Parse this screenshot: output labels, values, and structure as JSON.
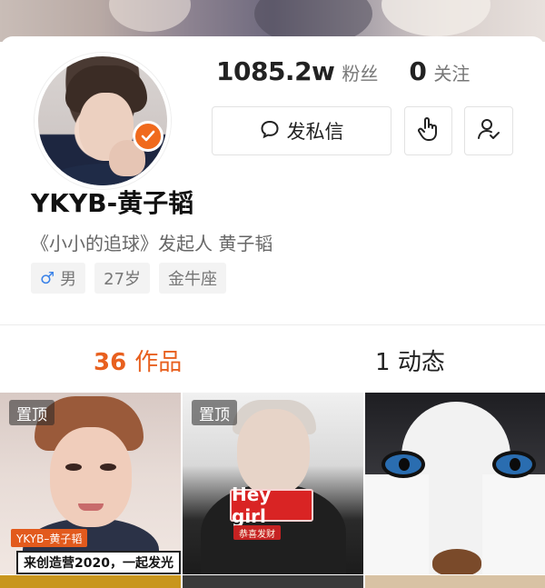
{
  "profile": {
    "followers_count": "1085.2w",
    "followers_label": "粉丝",
    "following_count": "0",
    "following_label": "关注",
    "message_button_label": "发私信",
    "name": "YKYB-黄子韬",
    "bio": "《小小的追球》发起人 黄子韬",
    "tags": {
      "gender_symbol": "♂",
      "gender": "男",
      "age": "27岁",
      "zodiac": "金牛座"
    },
    "verified": true,
    "accent_color": "#e8601f"
  },
  "tabs": {
    "works_count": "36",
    "works_label": "作品",
    "dynamic_count": "1",
    "dynamic_label": "动态"
  },
  "videos": [
    {
      "pinned_label": "置顶",
      "overlay_name": "YKYB–黄子韬",
      "overlay_caption": "来创造营2020，一起发光"
    },
    {
      "pinned_label": "置顶",
      "overlay_title": "Hey girl",
      "overlay_sub": "恭喜发财"
    },
    {
      "pinned_label": ""
    }
  ],
  "icons": [
    "message-bubble-icon",
    "touch-hand-icon",
    "user-check-icon",
    "verified-check-icon",
    "male-icon"
  ]
}
